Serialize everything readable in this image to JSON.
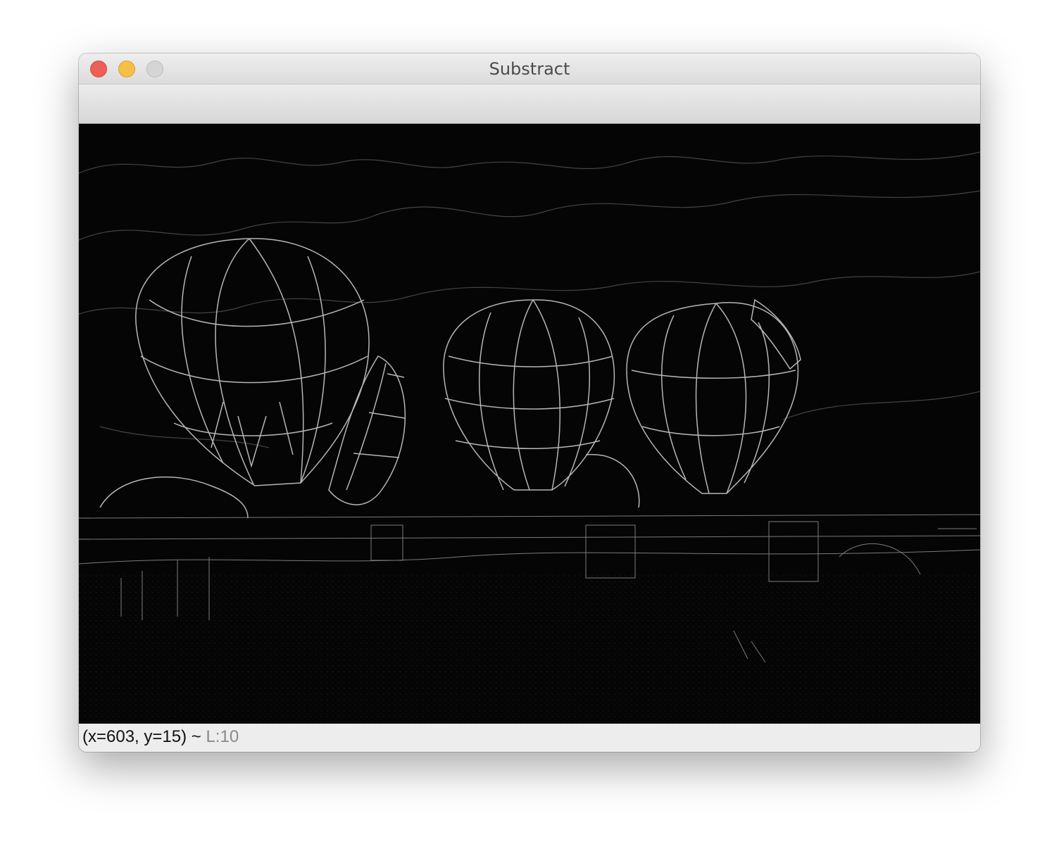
{
  "window": {
    "title": "Substract"
  },
  "traffic_lights": {
    "close_icon": "red-close-circle",
    "minimize_icon": "yellow-minimize-circle",
    "zoom_icon": "gray-zoom-circle"
  },
  "status": {
    "coordinates": "(x=603, y=15) ~ ",
    "level": "L:10"
  },
  "colors": {
    "image_background": "#050505",
    "edge_lines": "#b8b8b8"
  }
}
